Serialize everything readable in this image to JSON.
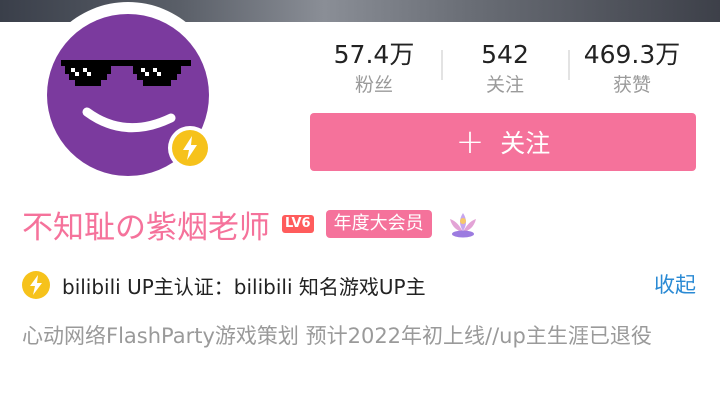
{
  "profile": {
    "username": "不知耻の紫烟老师",
    "level_badge": "LV6",
    "vip_badge": "年度大会员",
    "follow_button_label": "关注",
    "collapse_label": "收起",
    "certification": "bilibili UP主认证：bilibili 知名游戏UP主",
    "bio": "心动网络FlashParty游戏策划 预计2022年初上线//up主生涯已退役"
  },
  "stats": [
    {
      "value": "57.4万",
      "label": "粉丝"
    },
    {
      "value": "542",
      "label": "关注"
    },
    {
      "value": "469.3万",
      "label": "获赞"
    }
  ],
  "icons": {
    "avatar": "sunglasses-smiley-avatar",
    "verify": "lightning-bolt-icon",
    "follow": "plus-icon",
    "pendant": "lotus-pendant-icon"
  },
  "colors": {
    "accent_pink": "#f5729b",
    "avatar_purple": "#7b3a9e",
    "verify_yellow": "#f6c21b",
    "link_blue": "#2a8ad4",
    "level_red": "#ff5c5c"
  }
}
